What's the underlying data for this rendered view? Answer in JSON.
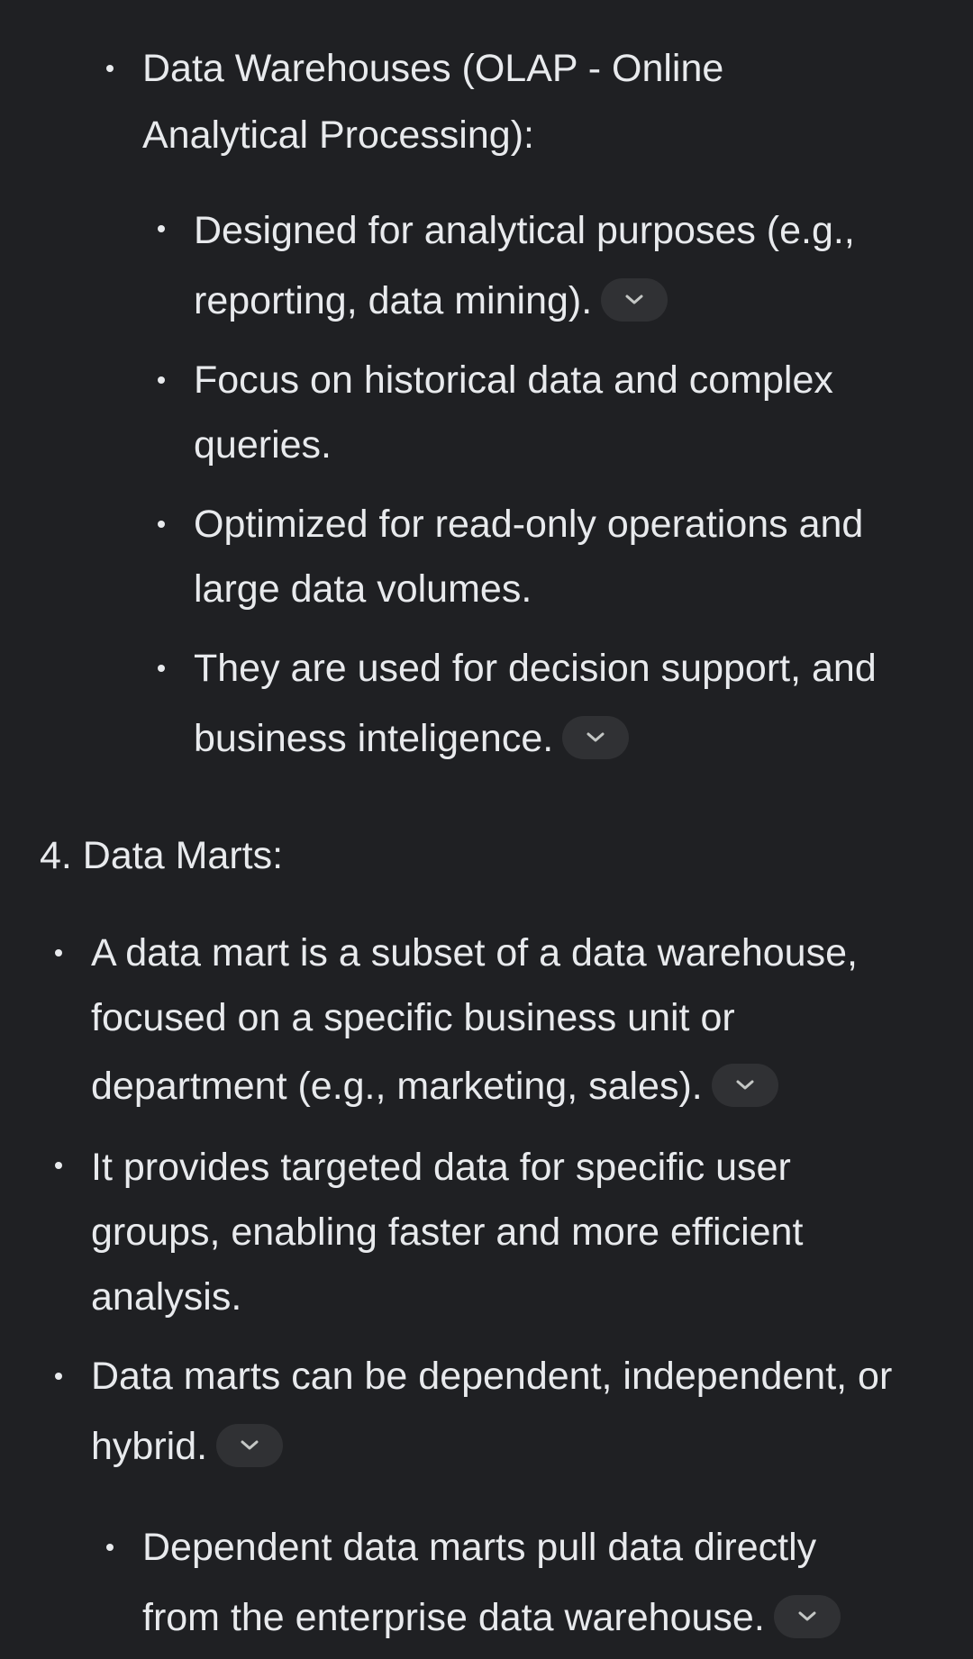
{
  "sections": [
    {
      "id": "olap",
      "title_line1": "Data Warehouses (OLAP - Online",
      "title_line2": "Analytical Processing):",
      "items": [
        {
          "line1": "Designed for analytical purposes (e.g.,",
          "line2": "reporting, data mining)."
        },
        {
          "line1": "Focus on historical data and complex",
          "line2": "queries."
        },
        {
          "line1": "Optimized for read-only operations and",
          "line2": "large data volumes."
        },
        {
          "line1": "They are used for decision support, and",
          "line2": "business inteligence."
        }
      ]
    },
    {
      "id": "data-marts",
      "heading": "4. Data Marts:",
      "items": [
        {
          "line1": "A data mart is a subset of a data warehouse,",
          "line2": "focused on a specific business unit or",
          "line3": "department (e.g., marketing, sales)."
        },
        {
          "line1": "It provides targeted data for specific user",
          "line2": "groups, enabling faster and more efficient",
          "line3": "analysis."
        },
        {
          "line1": "Data marts can be dependent, independent, or",
          "line2": "hybrid."
        }
      ],
      "subitems": [
        {
          "line1": "Dependent data marts pull data directly",
          "line2": "from the enterprise data warehouse."
        }
      ]
    }
  ],
  "icons": {
    "source_chip": "chevron-down-icon"
  },
  "colors": {
    "background": "#1f2023",
    "text": "#e8eaed",
    "chip": "#303134",
    "chevron": "#c4c7c5"
  }
}
